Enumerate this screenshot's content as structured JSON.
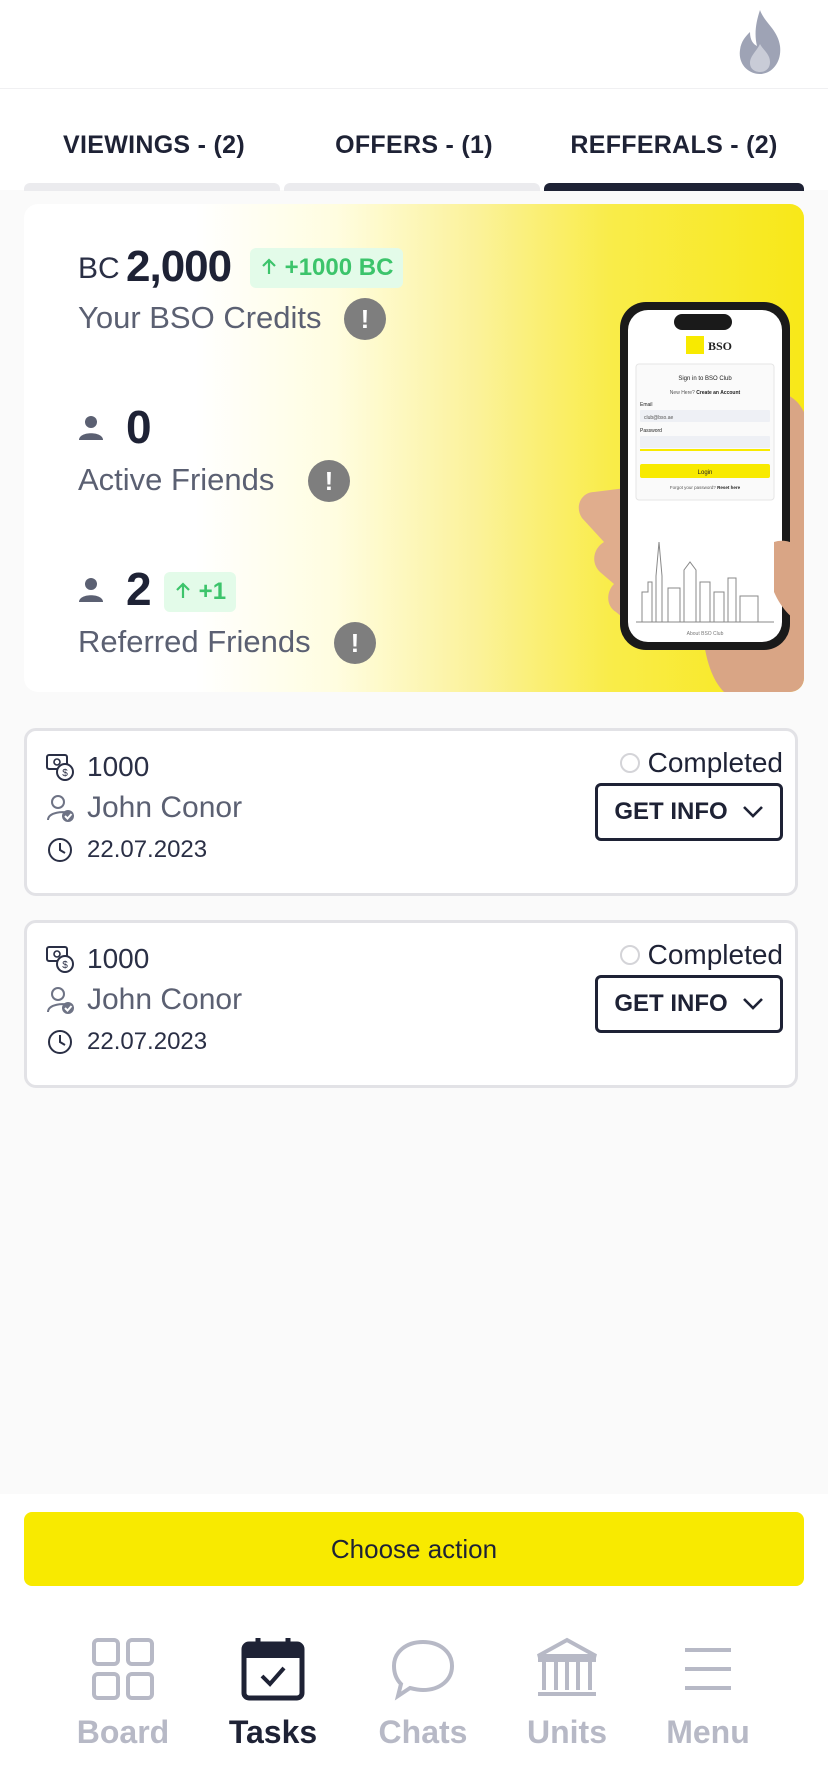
{
  "tabs": [
    {
      "label": "VIEWINGS - (2)"
    },
    {
      "label": "OFFERS - (1)"
    },
    {
      "label": "REFFERALS - (2)"
    }
  ],
  "hero": {
    "bc_prefix": "BC",
    "bc_value": "2,000",
    "bc_delta": "+1000 BC",
    "credits_label": "Your BSO Credits",
    "active_friends_value": "0",
    "active_friends_label": "Active Friends",
    "referred_friends_value": "2",
    "referred_friends_delta": "+1",
    "referred_friends_label": "Referred Friends",
    "info_mark": "!",
    "phone_screen": {
      "brand": "BSO",
      "sign_in": "Sign in to BSO Club",
      "new_here": "New Here?",
      "create_account": "Create an Account",
      "email_label": "Email",
      "email_value": "club@bso.ae",
      "password_label": "Password",
      "login": "Login",
      "forgot": "Forgot your password?",
      "reset": "Reset here",
      "about": "About BSO Club"
    }
  },
  "referrals": [
    {
      "amount": "1000",
      "name": "John Conor",
      "date": "22.07.2023",
      "status": "Completed",
      "action": "GET INFO"
    },
    {
      "amount": "1000",
      "name": "John Conor",
      "date": "22.07.2023",
      "status": "Completed",
      "action": "GET INFO"
    }
  ],
  "action_button": "Choose action",
  "nav": [
    {
      "label": "Board",
      "icon": "grid-icon"
    },
    {
      "label": "Tasks",
      "icon": "calendar-check-icon"
    },
    {
      "label": "Chats",
      "icon": "chat-bubble-icon"
    },
    {
      "label": "Units",
      "icon": "building-columns-icon"
    },
    {
      "label": "Menu",
      "icon": "hamburger-icon"
    }
  ],
  "colors": {
    "primary_dark": "#1e2235",
    "accent_yellow": "#f8ea00",
    "badge_green": "#3cc46b",
    "nav_inactive": "#b7b9c6"
  }
}
